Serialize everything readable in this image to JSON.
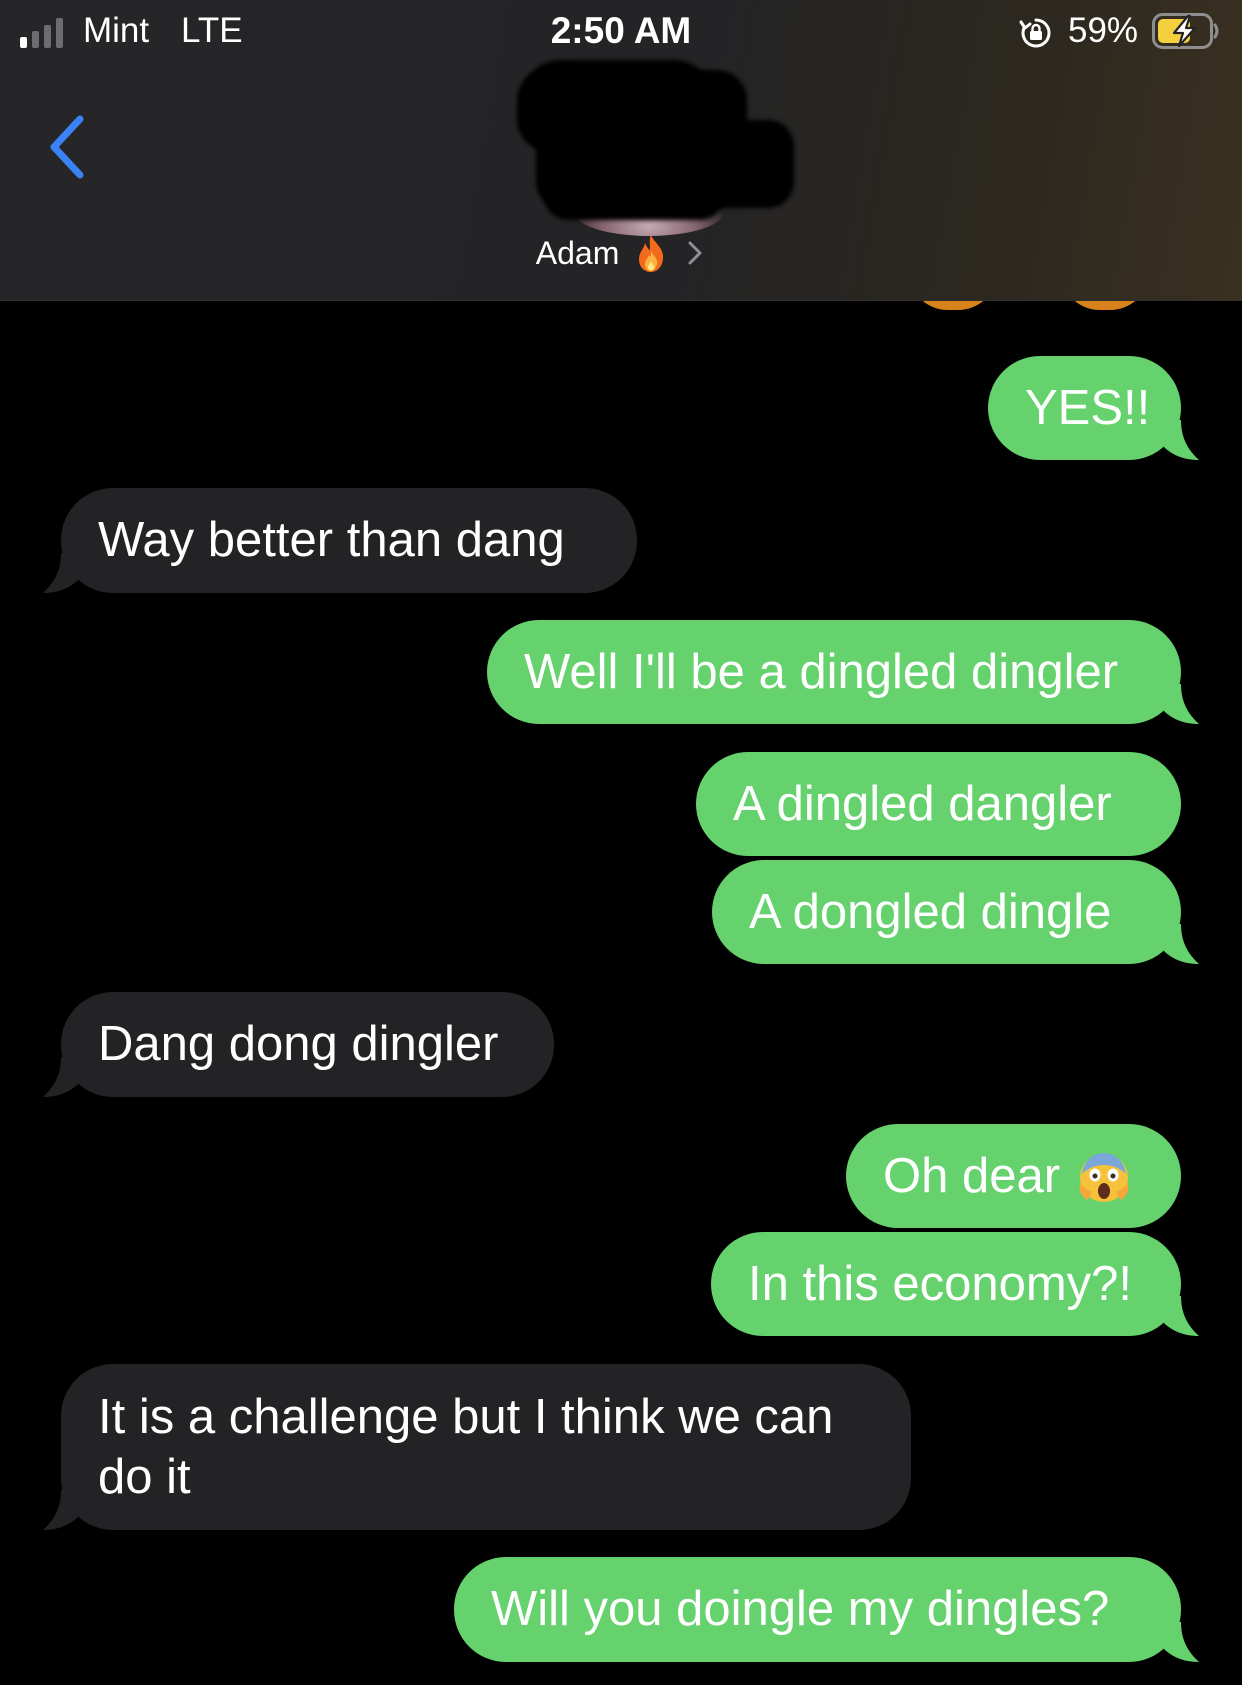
{
  "status_bar": {
    "carrier": "Mint",
    "network": "LTE",
    "time": "2:50 AM",
    "battery_percent": "59%",
    "signal_bars_active": 1,
    "signal_bars_total": 4,
    "charging": true,
    "orientation_lock": true
  },
  "header": {
    "contact_name": "Adam",
    "contact_emoji": "fire-icon",
    "avatar_redacted": true
  },
  "colors": {
    "sent_bubble": "#65d26e",
    "received_bubble": "#232326",
    "back_chevron": "#3b82f6",
    "background": "#000000"
  },
  "messages": [
    {
      "direction": "sent",
      "text": "YES!!"
    },
    {
      "direction": "received",
      "text": "Way better than dang"
    },
    {
      "direction": "sent",
      "text": "Well I'll be a dingled dingler"
    },
    {
      "direction": "sent",
      "text": "A dingled dangler"
    },
    {
      "direction": "sent",
      "text": "A dongled dingle"
    },
    {
      "direction": "received",
      "text": "Dang dong dingler"
    },
    {
      "direction": "sent",
      "text": "Oh dear",
      "emoji": "face-screaming-in-fear-icon"
    },
    {
      "direction": "sent",
      "text": "In this economy?!"
    },
    {
      "direction": "received",
      "text": "It is a challenge but I think we can do it"
    },
    {
      "direction": "sent",
      "text": "Will you doingle my dingles?"
    }
  ]
}
